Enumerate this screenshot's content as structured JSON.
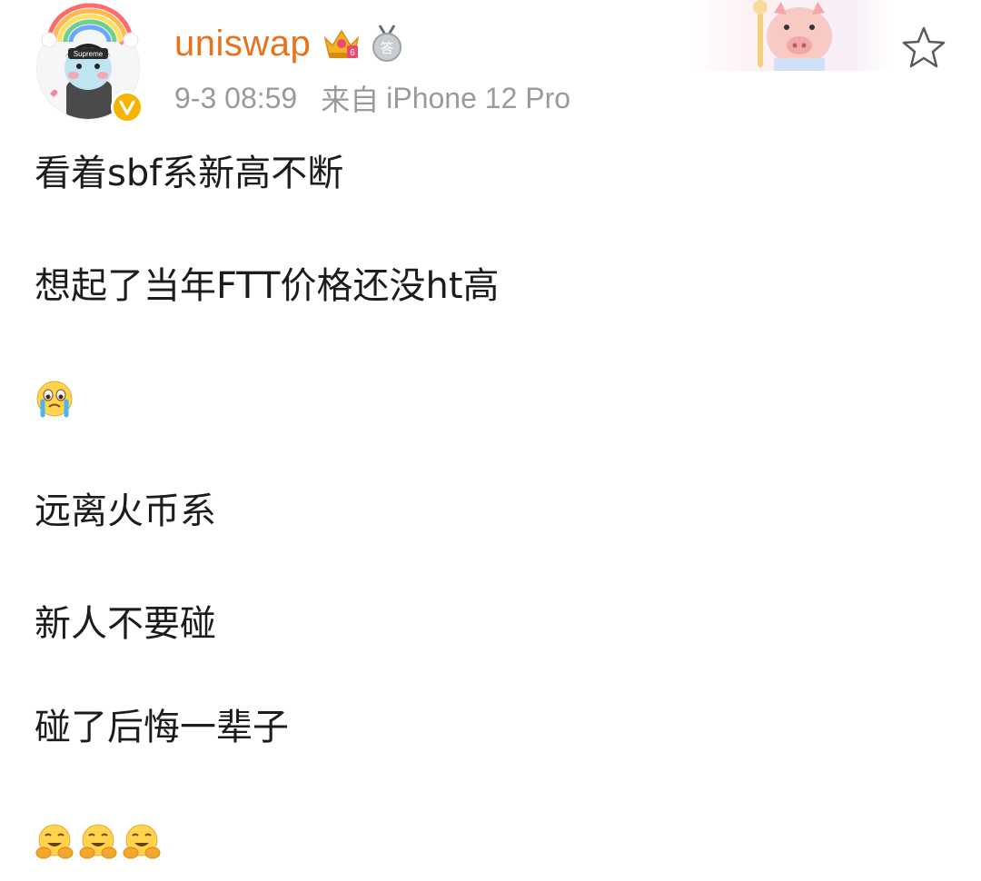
{
  "header": {
    "username": "uniswap",
    "time": "9-3 08:59",
    "source_prefix": "来自",
    "source": "iPhone 12 Pro",
    "crown_badge_icon": "crown-badge-icon",
    "crown_badge_text": "6",
    "answer_badge_icon": "answer-medal-icon",
    "answer_badge_text": "答",
    "avatar_text": "Supreme",
    "verified_icon": "verified-v-icon",
    "star_icon": "star-outline-icon"
  },
  "post": {
    "lines": [
      "看着sbf系新高不断",
      "想起了当年FTT价格还没ht高",
      "远离火币系",
      "新人不要碰",
      "碰了后悔一辈子"
    ],
    "emoji_1": "crying-face-emoji",
    "emoji_2": [
      "hugging-face-emoji",
      "hugging-face-emoji",
      "hugging-face-emoji"
    ]
  },
  "colors": {
    "username": "#e8721c",
    "meta": "#9a9a9a",
    "verified": "#f6b400",
    "text": "#1c1c1c"
  }
}
